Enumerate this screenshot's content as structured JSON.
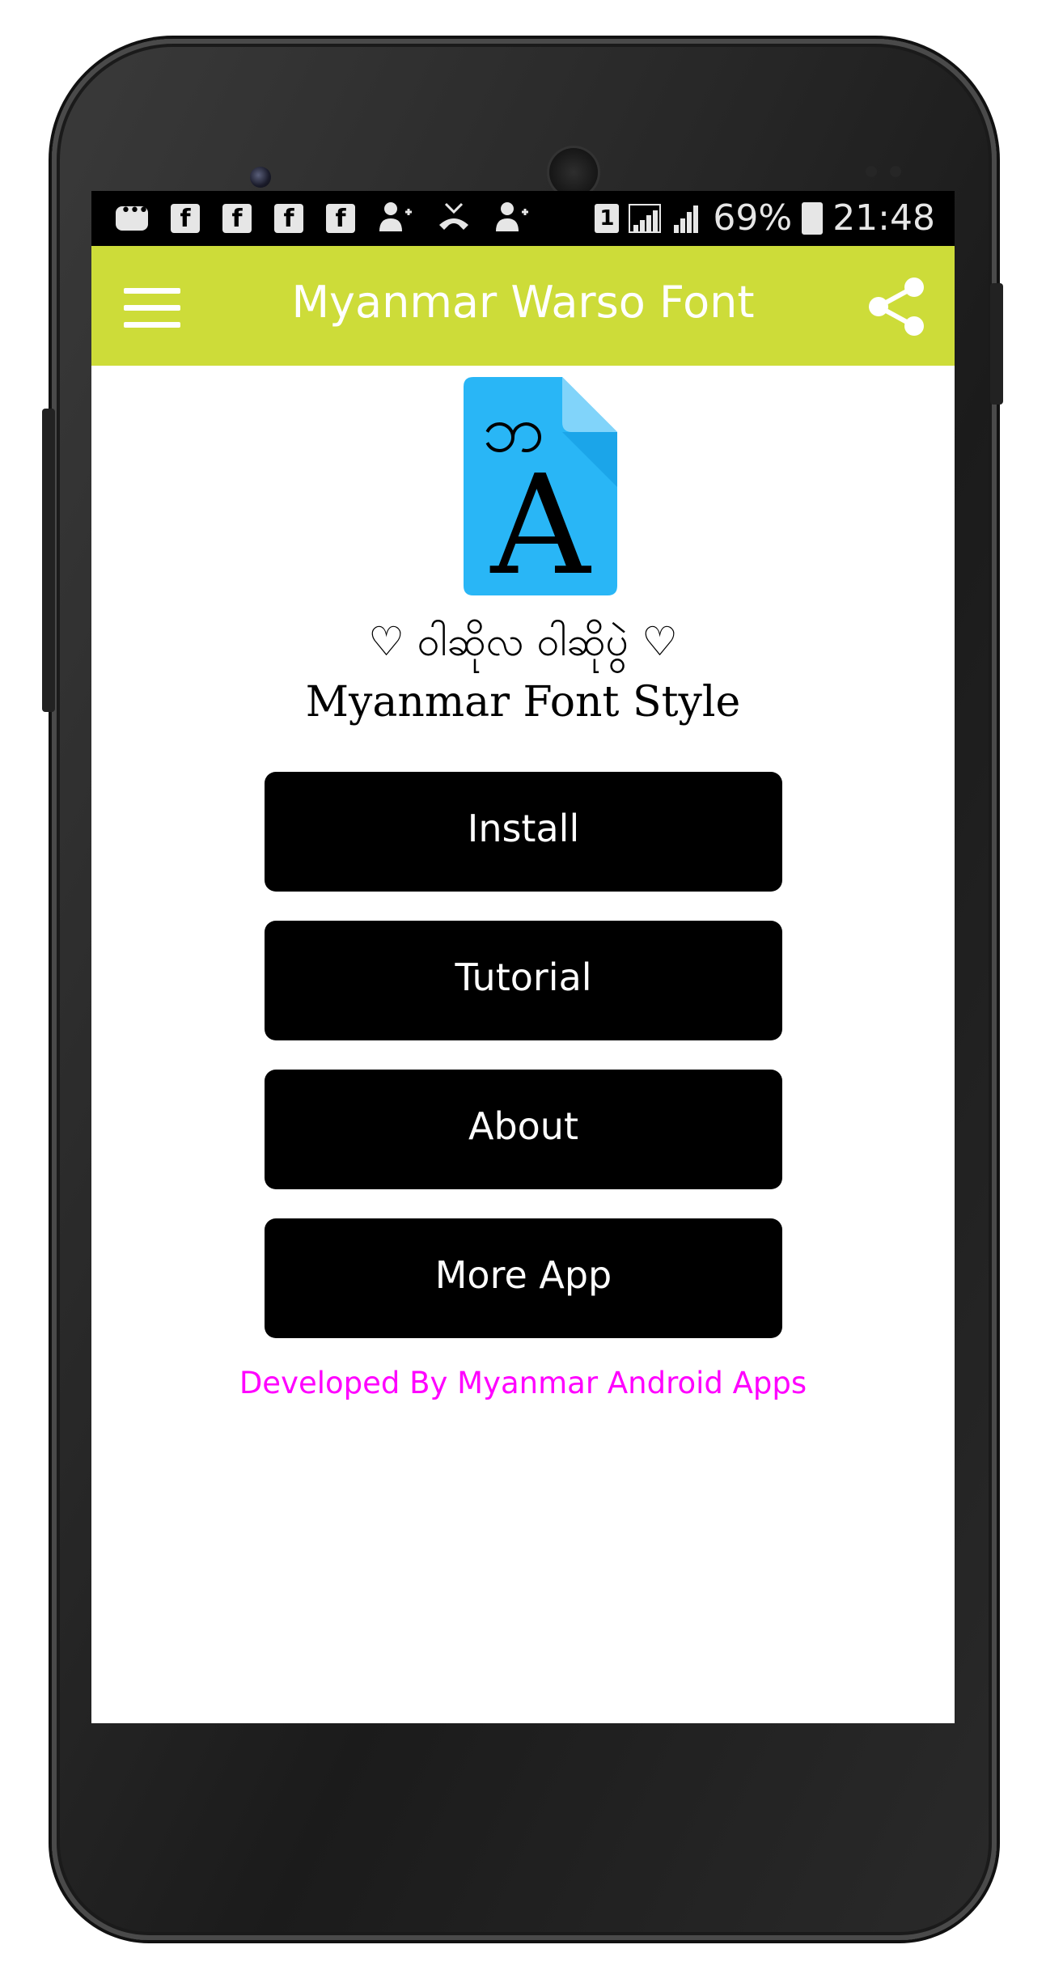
{
  "status_bar": {
    "icons": [
      "message-icon",
      "facebook-icon",
      "facebook-icon",
      "facebook-icon",
      "facebook-icon",
      "add-contact-icon",
      "missed-call-icon",
      "add-contact-icon"
    ],
    "fb_glyph": "f",
    "sim": "1",
    "battery": "69%",
    "time": "21:48"
  },
  "app_bar": {
    "title": "Myanmar Warso Font",
    "background": "#cddc39",
    "menu_icon": "hamburger-menu-icon",
    "share_icon": "share-icon"
  },
  "logo": {
    "top_glyph": "ဘ",
    "letter": "A",
    "color": "#29b6f6"
  },
  "tagline": "♡ ဝါဆိုလ ဝါဆိုပွဲ ♡",
  "subtitle": "Myanmar Font Style",
  "buttons": {
    "install": "Install",
    "tutorial": "Tutorial",
    "about": "About",
    "more_app": "More App"
  },
  "footer": {
    "credit": "Developed By Myanmar Android Apps",
    "color": "#ff00ff"
  }
}
